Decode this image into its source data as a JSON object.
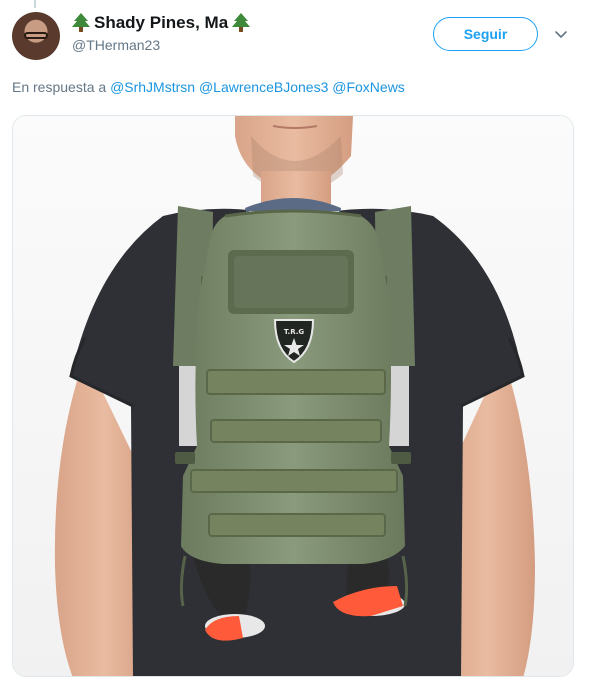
{
  "tweet": {
    "display_name": "Shady Pines, Ma",
    "name_emoji_left": "tree-icon",
    "name_emoji_right": "tree-icon",
    "handle": "@THerman23",
    "follow_label": "Seguir",
    "reply_prefix": "En respuesta a",
    "reply_mentions": [
      "@SrhJMstrsn",
      "@LawrenceBJones3",
      "@FoxNews"
    ],
    "media": {
      "patch_text": "T.R.G",
      "description_icon": "photo-tactical-baby-carrier"
    }
  },
  "colors": {
    "accent": "#1da1f2",
    "link": "#1b95e0",
    "secondary_text": "#657786",
    "carrier_green": "#7b8a6d",
    "shirt": "#2e3035"
  }
}
